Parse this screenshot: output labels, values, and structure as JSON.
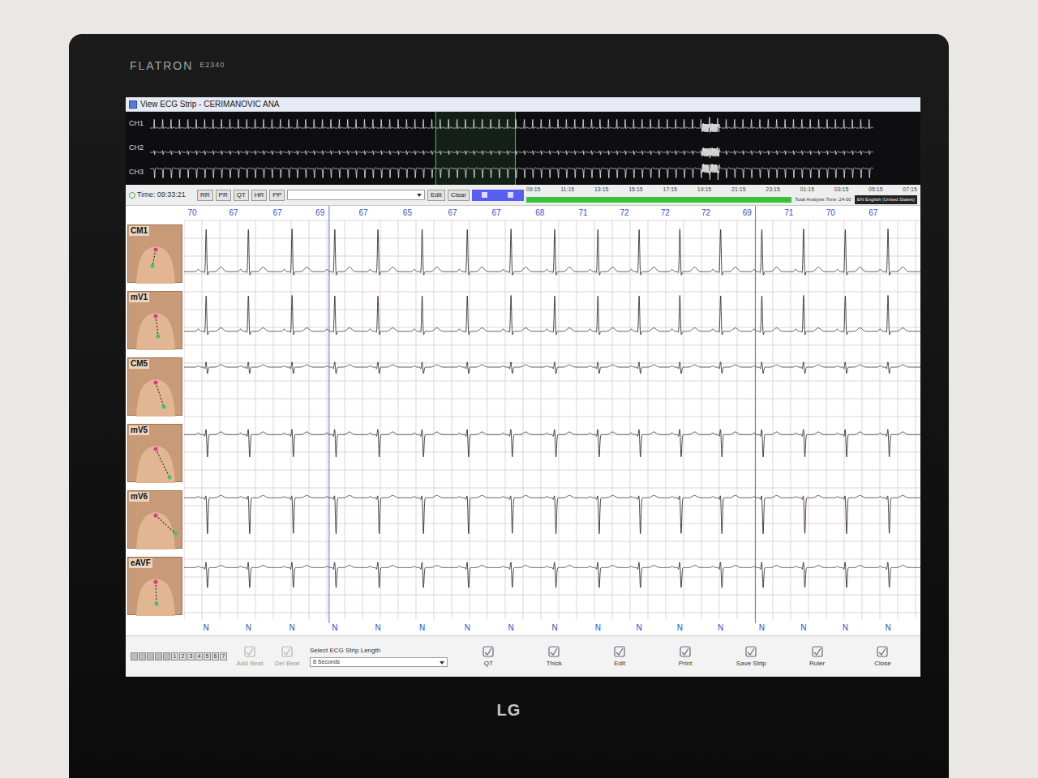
{
  "monitor": {
    "brand": "FLATRON",
    "model": "E2340",
    "logo": "LG"
  },
  "window": {
    "title": "View ECG Strip - CERIMANOVIC  ANA"
  },
  "overview": {
    "channels": [
      {
        "name": "CH1",
        "r": 1.0,
        "s": -0.15
      },
      {
        "name": "CH2",
        "r": 0.25,
        "s": -0.3
      },
      {
        "name": "CH3",
        "r": -0.2,
        "s": -1.0
      }
    ],
    "beat_count": 86,
    "selection": {
      "start": 0.395,
      "end": 0.505
    },
    "noise_at": 0.775
  },
  "toolbar": {
    "time": "Time: 09:33:21",
    "buttons": [
      {
        "label": "RR",
        "selected": false
      },
      {
        "label": "PR",
        "selected": false
      },
      {
        "label": "QT",
        "selected": false
      },
      {
        "label": "HR",
        "selected": false
      },
      {
        "label": "PP",
        "selected": false
      }
    ],
    "edit": "Edit",
    "clear": "Clear"
  },
  "timeline": {
    "ticks": [
      "09:15",
      "11:15",
      "13:15",
      "15:15",
      "17:15",
      "19:15",
      "21:15",
      "23:15",
      "01:15",
      "03:15",
      "05:15",
      "07:15"
    ],
    "total": "Total Analysis Time: 24:00",
    "level": 1.0,
    "language": "EN English (United States)"
  },
  "strip": {
    "duration_s": 15,
    "markers": [
      0.197,
      0.776
    ],
    "beats": [
      {
        "t": 0.45,
        "hr": "70",
        "label": "N"
      },
      {
        "t": 1.31,
        "hr": "67",
        "label": "N"
      },
      {
        "t": 2.2,
        "hr": "67",
        "label": "N"
      },
      {
        "t": 3.07,
        "hr": "69",
        "label": "N"
      },
      {
        "t": 3.95,
        "hr": "67",
        "label": "N"
      },
      {
        "t": 4.85,
        "hr": "65",
        "label": "N"
      },
      {
        "t": 5.77,
        "hr": "67",
        "label": "N"
      },
      {
        "t": 6.66,
        "hr": "67",
        "label": "N"
      },
      {
        "t": 7.55,
        "hr": "68",
        "label": "N"
      },
      {
        "t": 8.43,
        "hr": "71",
        "label": "N"
      },
      {
        "t": 9.27,
        "hr": "72",
        "label": "N"
      },
      {
        "t": 10.1,
        "hr": "72",
        "label": "N"
      },
      {
        "t": 10.93,
        "hr": "72",
        "label": "N"
      },
      {
        "t": 11.77,
        "hr": "69",
        "label": "N"
      },
      {
        "t": 12.62,
        "hr": "71",
        "label": "N"
      },
      {
        "t": 13.47,
        "hr": "70",
        "label": "N"
      },
      {
        "t": 14.34,
        "hr": "67",
        "label": "N"
      }
    ],
    "leads": [
      {
        "name": "CM1",
        "p": 0.1,
        "r": 1.9,
        "s": -0.2,
        "t": 0.2
      },
      {
        "name": "mV1",
        "p": 0.1,
        "r": 1.6,
        "s": -0.2,
        "t": 0.15
      },
      {
        "name": "CM5",
        "p": 0.05,
        "r": 0.25,
        "s": -0.3,
        "t": 0.1
      },
      {
        "name": "mV5",
        "p": 0.08,
        "r": 0.3,
        "s": -1.0,
        "t": 0.12
      },
      {
        "name": "mV6",
        "p": 0.05,
        "r": 0.15,
        "s": -1.6,
        "t": 0.1
      },
      {
        "name": "eAVF",
        "p": 0.06,
        "r": 0.3,
        "s": -0.9,
        "t": 0.1
      }
    ]
  },
  "bottom": {
    "pages": [
      {
        "label": "1",
        "selected": false
      },
      {
        "label": "2",
        "selected": false
      },
      {
        "label": "3",
        "selected": false
      },
      {
        "label": "4",
        "selected": false
      },
      {
        "label": "5",
        "selected": false
      },
      {
        "label": "6",
        "selected": false
      },
      {
        "label": "7",
        "selected": false
      }
    ],
    "add_beat": {
      "label": "Add Beat",
      "disabled": true
    },
    "del_beat": {
      "label": "Del Beat",
      "disabled": true
    },
    "length_label": "Select ECG Strip Length",
    "length_value": "8 Seconds",
    "tools": [
      "QT",
      "Thick",
      "Edit",
      "Print",
      "Save Strip",
      "Ruler",
      "Close"
    ]
  }
}
